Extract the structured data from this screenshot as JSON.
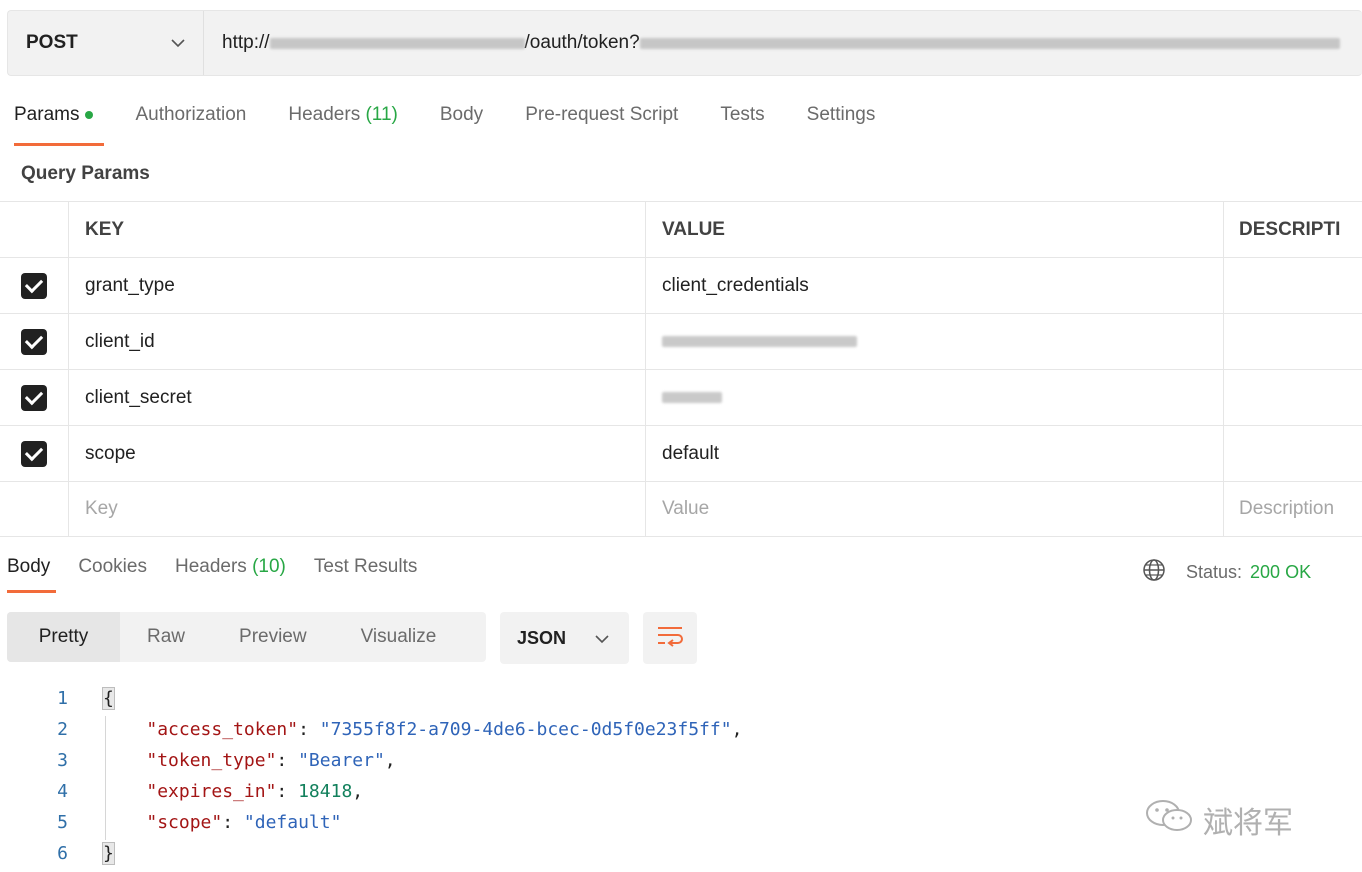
{
  "request": {
    "method": "POST",
    "url_prefix": "http://",
    "url_path": "/oauth/token?"
  },
  "request_tabs": [
    {
      "label": "Params",
      "active": true
    },
    {
      "label": "Authorization"
    },
    {
      "label": "Headers",
      "count": "(11)"
    },
    {
      "label": "Body"
    },
    {
      "label": "Pre-request Script"
    },
    {
      "label": "Tests"
    },
    {
      "label": "Settings"
    }
  ],
  "query_params": {
    "title": "Query Params",
    "headers": {
      "key": "KEY",
      "value": "VALUE",
      "description": "DESCRIPTI"
    },
    "rows": [
      {
        "checked": true,
        "key": "grant_type",
        "value": "client_credentials"
      },
      {
        "checked": true,
        "key": "client_id",
        "value": ""
      },
      {
        "checked": true,
        "key": "client_secret",
        "value": ""
      },
      {
        "checked": true,
        "key": "scope",
        "value": "default"
      }
    ],
    "placeholders": {
      "key": "Key",
      "value": "Value",
      "description": "Description"
    }
  },
  "response_tabs": [
    {
      "label": "Body",
      "active": true
    },
    {
      "label": "Cookies"
    },
    {
      "label": "Headers",
      "count": "(10)"
    },
    {
      "label": "Test Results"
    }
  ],
  "status": {
    "label": "Status:",
    "value": "200 OK"
  },
  "view_modes": [
    "Pretty",
    "Raw",
    "Preview",
    "Visualize"
  ],
  "format": "JSON",
  "code_lines": [
    {
      "n": "1",
      "t": "{"
    },
    {
      "n": "2",
      "key": "\"access_token\"",
      "val": "\"7355f8f2-a709-4de6-bcec-0d5f0e23f5ff\"",
      "kind": "s",
      "comma": ","
    },
    {
      "n": "3",
      "key": "\"token_type\"",
      "val": "\"Bearer\"",
      "kind": "s",
      "comma": ","
    },
    {
      "n": "4",
      "key": "\"expires_in\"",
      "val": "18418",
      "kind": "n",
      "comma": ","
    },
    {
      "n": "5",
      "key": "\"scope\"",
      "val": "\"default\"",
      "kind": "s",
      "comma": ""
    },
    {
      "n": "6",
      "t": "}"
    }
  ],
  "watermark": "斌将军",
  "colors": {
    "accent": "#f26b3a",
    "success": "#28a745"
  }
}
